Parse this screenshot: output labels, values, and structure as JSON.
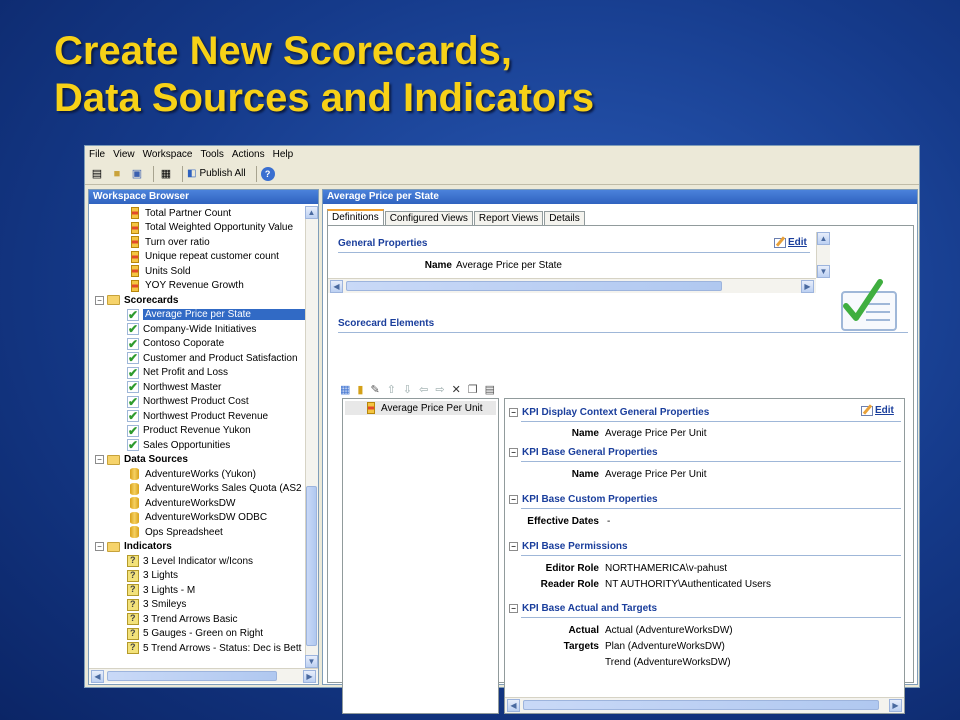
{
  "slide": {
    "title_line1": "Create New Scorecards,",
    "title_line2": "Data Sources and Indicators"
  },
  "menu": [
    "File",
    "View",
    "Workspace",
    "Tools",
    "Actions",
    "Help"
  ],
  "toolbar": {
    "publish_all": "Publish All",
    "help": "?"
  },
  "workspace": {
    "header": "Workspace Browser",
    "kpis": [
      "Total Partner Count",
      "Total Weighted Opportunity Value",
      "Turn over ratio",
      "Unique repeat customer count",
      "Units Sold",
      "YOY Revenue Growth"
    ],
    "scorecards_label": "Scorecards",
    "scorecards": [
      "Average Price per State",
      "Company-Wide Initiatives",
      "Contoso Coporate",
      "Customer and Product Satisfaction",
      "Net Profit and Loss",
      "Northwest Master",
      "Northwest Product Cost",
      "Northwest Product Revenue",
      "Product Revenue Yukon",
      "Sales Opportunities"
    ],
    "datasources_label": "Data Sources",
    "datasources": [
      "AdventureWorks (Yukon)",
      "AdventureWorks Sales Quota (AS2",
      "AdventureWorksDW",
      "AdventureWorksDW ODBC",
      "Ops Spreadsheet"
    ],
    "indicators_label": "Indicators",
    "indicators": [
      "3 Level Indicator w/Icons",
      "3 Lights",
      "3 Lights - M",
      "3 Smileys",
      "3 Trend Arrows Basic",
      "5 Gauges - Green on Right",
      "5 Trend Arrows - Status: Dec is Bett"
    ]
  },
  "editor": {
    "header": "Average Price per State",
    "tabs": [
      "Definitions",
      "Configured Views",
      "Report Views",
      "Details"
    ],
    "general_title": "General Properties",
    "edit_label": "Edit",
    "name_label": "Name",
    "name_value": "Average Price per State",
    "elements_title": "Scorecard Elements",
    "element_item": "Average Price Per Unit",
    "kpi_sections": {
      "display_context": "KPI Display Context General Properties",
      "base_general": "KPI Base General Properties",
      "base_custom": "KPI Base Custom Properties",
      "base_permissions": "KPI Base Permissions",
      "base_actual": "KPI Base Actual and Targets"
    },
    "kpi_name_label": "Name",
    "kpi_name_value": "Average Price Per Unit",
    "base_name_value": "Average Price Per Unit",
    "effective_dates_label": "Effective Dates",
    "effective_dates_value": "-",
    "editor_role_label": "Editor Role",
    "editor_role_value": "NORTHAMERICA\\v-pahust",
    "reader_role_label": "Reader Role",
    "reader_role_value": "NT AUTHORITY\\Authenticated Users",
    "actual_label": "Actual",
    "actual_value": "Actual (AdventureWorksDW)",
    "targets_label": "Targets",
    "targets_values": [
      "Plan (AdventureWorksDW)",
      "Trend (AdventureWorksDW)"
    ]
  }
}
